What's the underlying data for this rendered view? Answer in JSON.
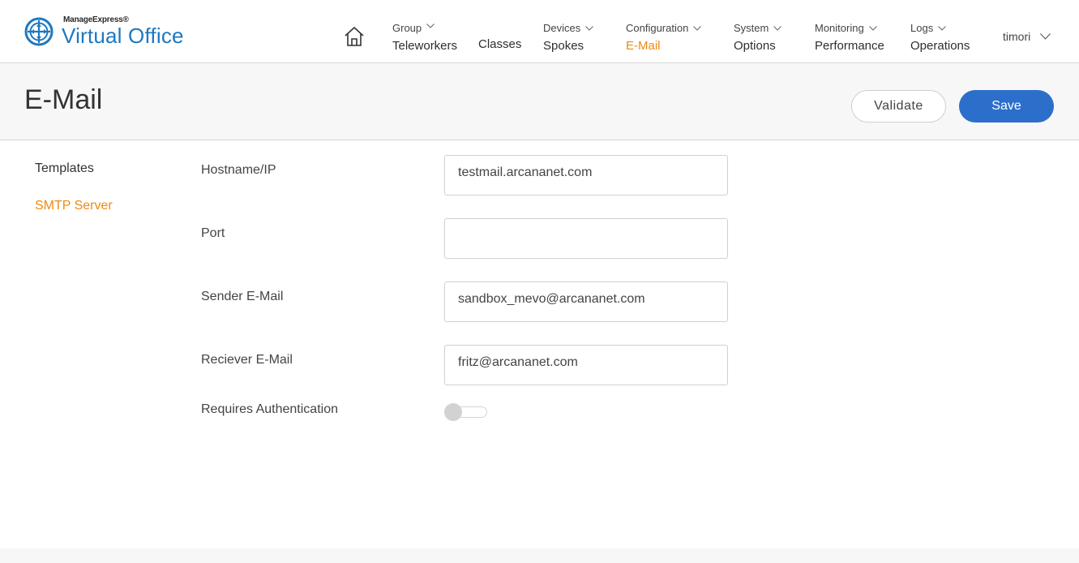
{
  "brand": {
    "small": "ManageExpress®",
    "big": "Virtual Office",
    "accent": "#1e78bf"
  },
  "nav": {
    "home_icon": "home-icon",
    "items": [
      {
        "top": "Group",
        "bottom": "Teleworkers"
      },
      {
        "bottom": "Classes"
      },
      {
        "top": "Devices",
        "bottom": "Spokes"
      },
      {
        "top": "Configuration",
        "bottom": "E-Mail"
      },
      {
        "top": "System",
        "bottom": "Options"
      },
      {
        "top": "Monitoring",
        "bottom": "Performance"
      },
      {
        "top": "Logs",
        "bottom": "Operations"
      }
    ],
    "active_color": "#f0890e",
    "user": "timori"
  },
  "page": {
    "title": "E-Mail",
    "validate_label": "Validate",
    "save_label": "Save",
    "save_color": "#2c6fcb"
  },
  "sidebar": {
    "items": [
      {
        "label": "Templates"
      },
      {
        "label": "SMTP Server"
      }
    ]
  },
  "form": {
    "hostname": {
      "label": "Hostname/IP",
      "value": "testmail.arcananet.com"
    },
    "port": {
      "label": "Port",
      "value": ""
    },
    "sender": {
      "label": "Sender E-Mail",
      "value": "sandbox_mevo@arcananet.com"
    },
    "receiver": {
      "label": "Reciever E-Mail",
      "value": "fritz@arcananet.com"
    },
    "auth": {
      "label": "Requires Authentication"
    }
  }
}
